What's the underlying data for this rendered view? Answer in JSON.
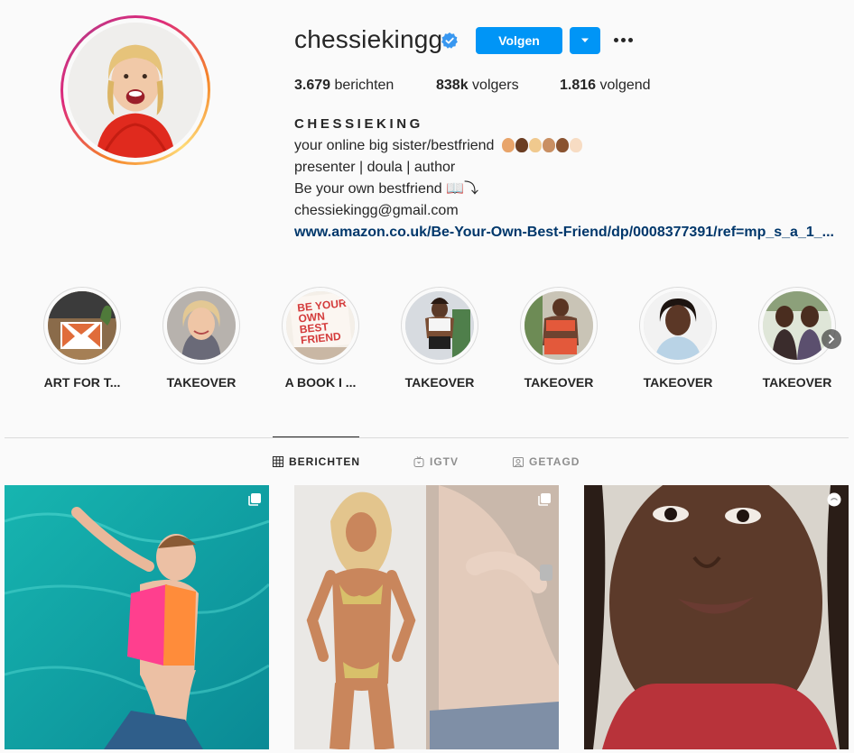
{
  "profile": {
    "username": "chessiekingg",
    "follow_label": "Volgen",
    "stats": {
      "posts_value": "3.679",
      "posts_label": "berichten",
      "followers_value": "838k",
      "followers_label": "volgers",
      "following_value": "1.816",
      "following_label": "volgend"
    },
    "bio": {
      "name": "CHESSIEKING",
      "line1": "your online big sister/bestfriend",
      "line2": "presenter | doula | author",
      "line3": "Be your own bestfriend 📖⤵",
      "email": "chessiekingg@gmail.com",
      "link": "www.amazon.co.uk/Be-Your-Own-Best-Friend/dp/0008377391/ref=mp_s_a_1_..."
    }
  },
  "highlights": [
    {
      "label": "ART FOR T..."
    },
    {
      "label": "TAKEOVER"
    },
    {
      "label": "A BOOK I ..."
    },
    {
      "label": "TAKEOVER"
    },
    {
      "label": "TAKEOVER"
    },
    {
      "label": "TAKEOVER"
    },
    {
      "label": "TAKEOVER"
    }
  ],
  "highlight_book_cover_text": "BE YOUR OWN BEST FRIEND",
  "tabs": [
    {
      "label": "BERICHTEN",
      "icon": "grid-icon",
      "active": true
    },
    {
      "label": "IGTV",
      "icon": "igtv-icon",
      "active": false
    },
    {
      "label": "GETAGD",
      "icon": "tagged-icon",
      "active": false
    }
  ],
  "posts": [
    {
      "badge": "carousel-icon"
    },
    {
      "badge": "carousel-icon"
    },
    {
      "badge": "igtv-icon"
    }
  ],
  "colors": {
    "accent": "#0095f6",
    "link": "#00376b",
    "text": "#262626",
    "muted": "#8e8e8e",
    "border": "#dbdbdb",
    "background": "#fafafa"
  }
}
